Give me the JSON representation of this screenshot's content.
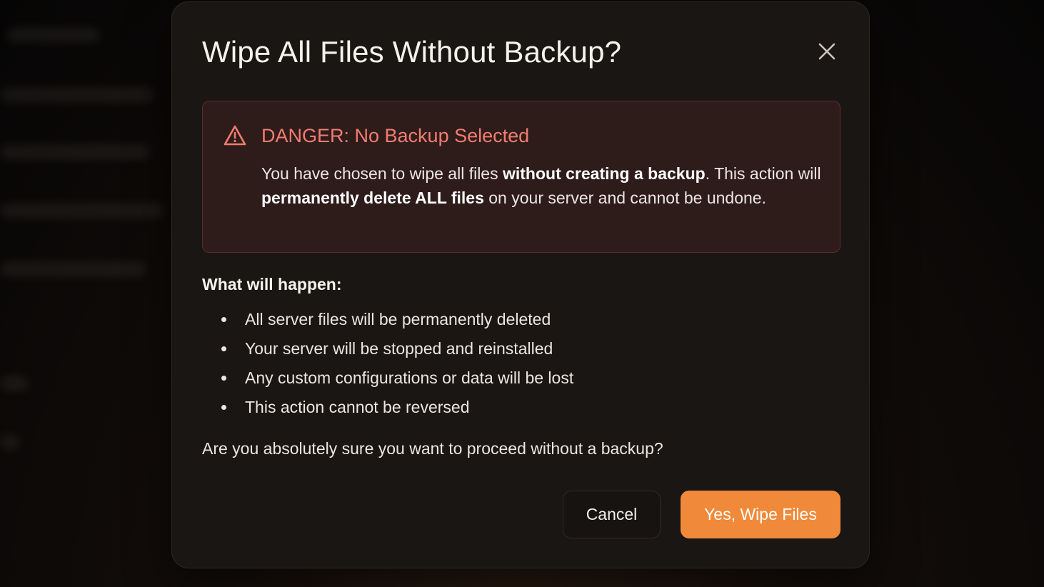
{
  "colors": {
    "accent": "#f08a3a",
    "danger": "#f07c70",
    "modal_bg": "#1a1614",
    "danger_bg": "#2e1c1b"
  },
  "dialog": {
    "title": "Wipe All Files Without Backup?",
    "close_icon": "close-icon",
    "danger": {
      "icon": "warning-triangle-icon",
      "title": "DANGER: No Backup Selected",
      "text_1": "You have chosen to wipe all files ",
      "bold_1": "without creating a backup",
      "text_2": ". This action will ",
      "bold_2": "permanently delete ALL files",
      "text_3": " on your server and cannot be undone."
    },
    "heading": "What will happen:",
    "bullets": [
      "All server files will be permanently deleted",
      "Your server will be stopped and reinstalled",
      "Any custom configurations or data will be lost",
      "This action cannot be reversed"
    ],
    "question": "Are you absolutely sure you want to proceed without a backup?",
    "cancel_label": "Cancel",
    "confirm_label": "Yes, Wipe Files"
  }
}
